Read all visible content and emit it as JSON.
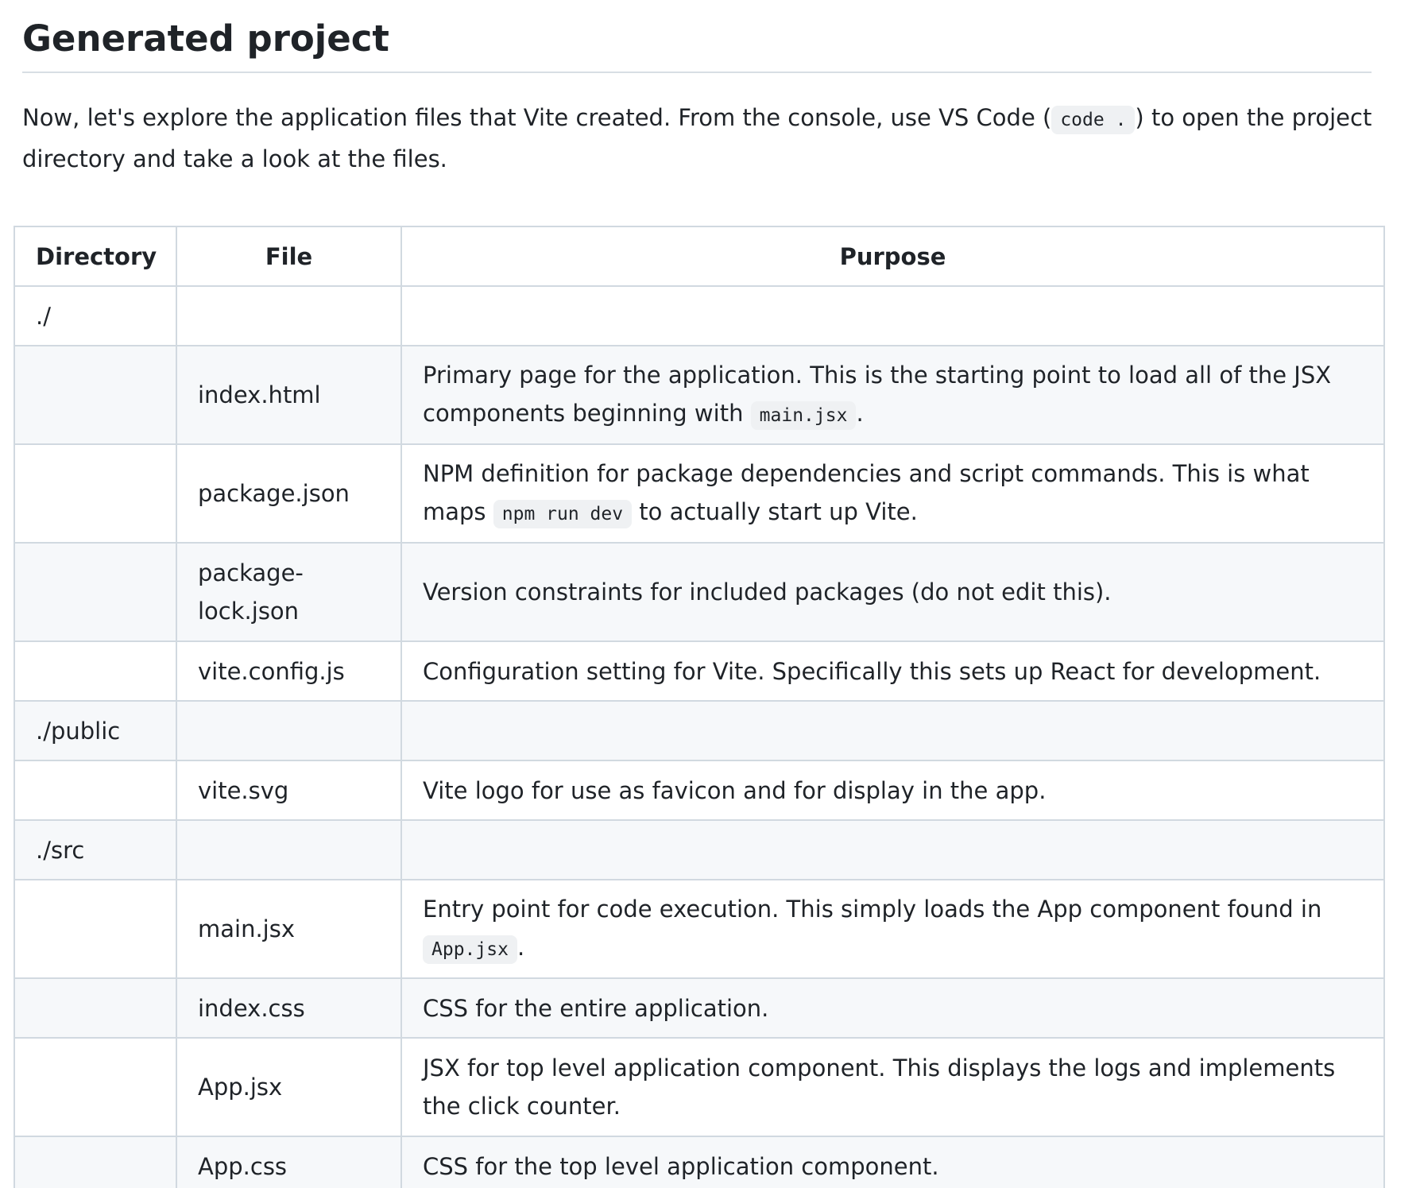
{
  "heading": "Generated project",
  "intro": {
    "before": "Now, let's explore the application files that Vite created. From the console, use VS Code (",
    "code": "code .",
    "after": ") to open the project directory and take a look at the files."
  },
  "table": {
    "headers": {
      "directory": "Directory",
      "file": "File",
      "purpose": "Purpose"
    },
    "rows": [
      {
        "directory": "./",
        "file": "",
        "purpose": "",
        "purpose_code": "",
        "purpose_after": ""
      },
      {
        "directory": "",
        "file": "index.html",
        "purpose": "Primary page for the application. This is the starting point to load all of the JSX components beginning with ",
        "purpose_code": "main.jsx",
        "purpose_after": "."
      },
      {
        "directory": "",
        "file": "package.json",
        "purpose": "NPM definition for package dependencies and script commands. This is what maps ",
        "purpose_code": "npm run dev",
        "purpose_after": " to actually start up Vite."
      },
      {
        "directory": "",
        "file": "package-lock.json",
        "purpose": "Version constraints for included packages (do not edit this).",
        "purpose_code": "",
        "purpose_after": ""
      },
      {
        "directory": "",
        "file": "vite.config.js",
        "purpose": "Configuration setting for Vite. Specifically this sets up React for development.",
        "purpose_code": "",
        "purpose_after": ""
      },
      {
        "directory": "./public",
        "file": "",
        "purpose": "",
        "purpose_code": "",
        "purpose_after": ""
      },
      {
        "directory": "",
        "file": "vite.svg",
        "purpose": "Vite logo for use as favicon and for display in the app.",
        "purpose_code": "",
        "purpose_after": ""
      },
      {
        "directory": "./src",
        "file": "",
        "purpose": "",
        "purpose_code": "",
        "purpose_after": ""
      },
      {
        "directory": "",
        "file": "main.jsx",
        "purpose": "Entry point for code execution. This simply loads the App component found in ",
        "purpose_code": "App.jsx",
        "purpose_after": "."
      },
      {
        "directory": "",
        "file": "index.css",
        "purpose": "CSS for the entire application.",
        "purpose_code": "",
        "purpose_after": ""
      },
      {
        "directory": "",
        "file": "App.jsx",
        "purpose": "JSX for top level application component. This displays the logs and implements the click counter.",
        "purpose_code": "",
        "purpose_after": ""
      },
      {
        "directory": "",
        "file": "App.css",
        "purpose": "CSS for the top level application component.",
        "purpose_code": "",
        "purpose_after": ""
      }
    ]
  }
}
